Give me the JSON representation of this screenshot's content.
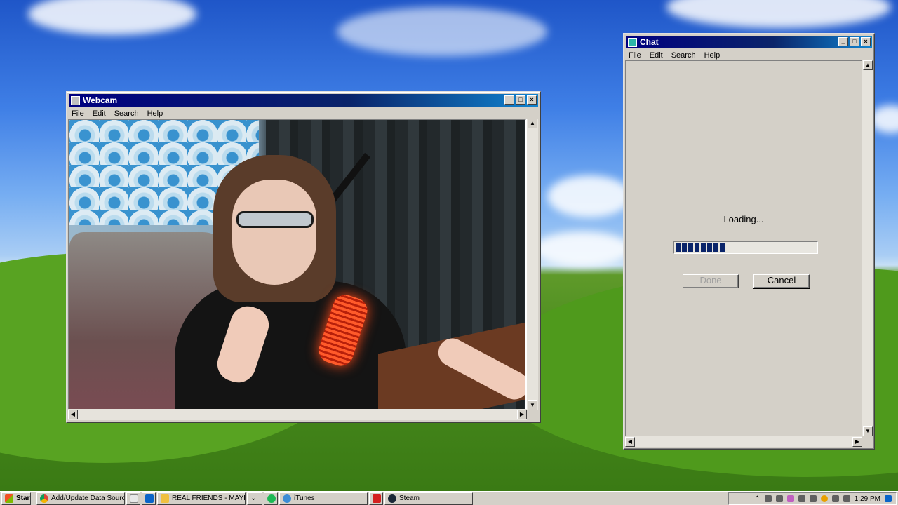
{
  "webcam_window": {
    "title": "Webcam",
    "menu": [
      "File",
      "Edit",
      "Search",
      "Help"
    ],
    "title_buttons": [
      "_",
      "□",
      "×"
    ]
  },
  "chat_window": {
    "title": "Chat",
    "menu": [
      "File",
      "Edit",
      "Search",
      "Help"
    ],
    "loading_text": "Loading...",
    "progress": 0.35,
    "done_label": "Done",
    "cancel_label": "Cancel",
    "title_buttons": [
      "_",
      "□",
      "×"
    ]
  },
  "taskbar": {
    "start_label": "Start",
    "items": [
      {
        "label": "Add/Update Data Source...",
        "icon": "chrome-icon"
      },
      {
        "label": "",
        "icon": "notepad-icon"
      },
      {
        "label": "",
        "icon": "outlook-icon"
      },
      {
        "label": "REAL FRIENDS - MAYB...",
        "icon": "folder-icon"
      },
      {
        "label": "",
        "icon": "chevron-icon"
      },
      {
        "label": "",
        "icon": "spotify-icon"
      },
      {
        "label": "iTunes",
        "icon": "itunes-icon"
      },
      {
        "label": "",
        "icon": "red-app-icon"
      },
      {
        "label": "Steam",
        "icon": "steam-icon"
      }
    ],
    "clock": "1:29 PM"
  },
  "colors": {
    "title_active": "#0a246a",
    "window_face": "#d4d0c8",
    "progress_fill": "#0a246a"
  }
}
